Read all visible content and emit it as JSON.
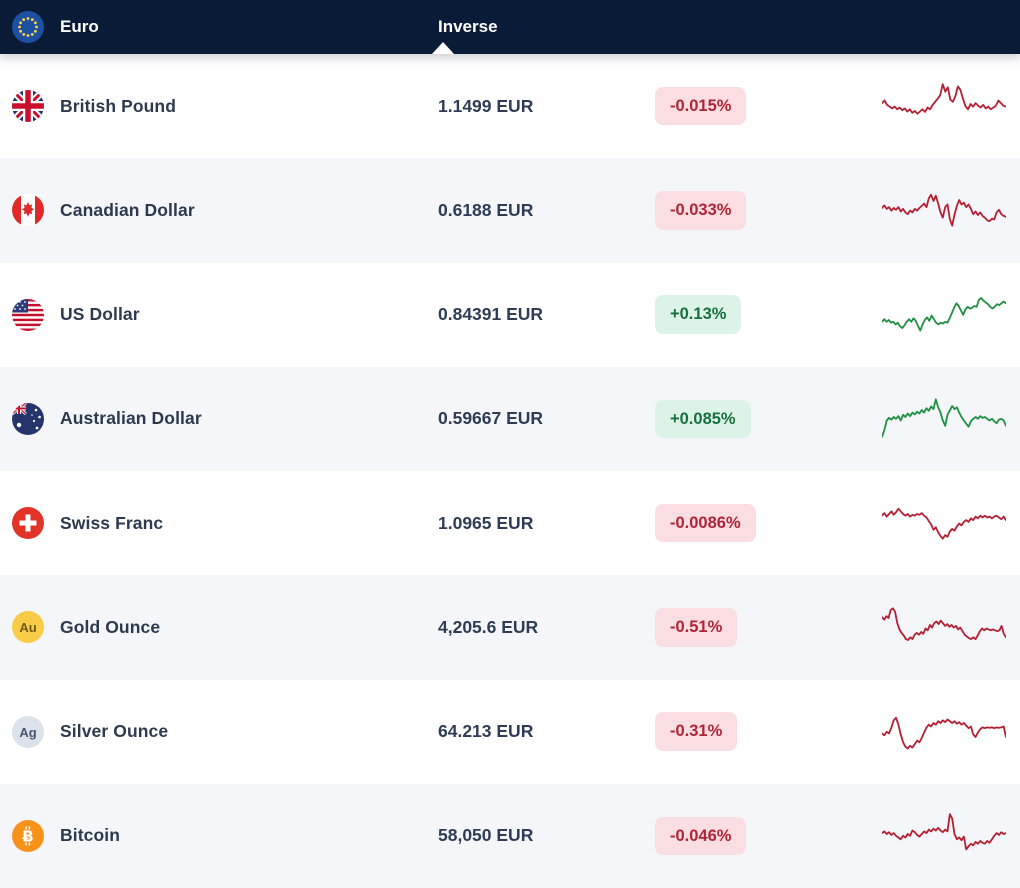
{
  "header": {
    "base_currency_label": "Euro",
    "base_flag_icon": "flag-eu",
    "column_label": "Inverse",
    "sort_indicator": "triangle-up"
  },
  "colors": {
    "header_bg": "#0a1b38",
    "row_alt_bg": "#f4f6f9",
    "text_dark": "#2d3a4e",
    "negative_text": "#b02437",
    "negative_bg": "#fbdee1",
    "positive_text": "#17713c",
    "positive_bg": "#def3e8",
    "spark_down": "#b41f33",
    "spark_up": "#1f8f41",
    "gold": "#f8cc46",
    "silver": "#dde2ea",
    "bitcoin_orange": "#f7931a"
  },
  "rows": [
    {
      "name": "British Pound",
      "icon": "flag-gb",
      "value": "1.1499 EUR",
      "change": "-0.015%",
      "direction": "down",
      "sparkline": [
        0.52,
        0.58,
        0.48,
        0.44,
        0.4,
        0.44,
        0.38,
        0.42,
        0.36,
        0.4,
        0.33,
        0.38,
        0.3,
        0.34,
        0.28,
        0.33,
        0.38,
        0.32,
        0.42,
        0.38,
        0.48,
        0.55,
        0.62,
        0.7,
        0.95,
        0.78,
        0.88,
        0.6,
        0.55,
        0.68,
        0.9,
        0.82,
        0.62,
        0.45,
        0.38,
        0.5,
        0.44,
        0.52,
        0.46,
        0.42,
        0.48,
        0.4,
        0.44,
        0.38,
        0.42,
        0.46,
        0.58,
        0.52,
        0.46,
        0.44
      ]
    },
    {
      "name": "Canadian Dollar",
      "icon": "flag-ca",
      "value": "0.6188 EUR",
      "change": "-0.033%",
      "direction": "down",
      "sparkline": [
        0.5,
        0.56,
        0.48,
        0.52,
        0.44,
        0.5,
        0.46,
        0.52,
        0.42,
        0.48,
        0.4,
        0.36,
        0.44,
        0.4,
        0.48,
        0.44,
        0.5,
        0.55,
        0.6,
        0.52,
        0.72,
        0.8,
        0.66,
        0.78,
        0.6,
        0.4,
        0.28,
        0.52,
        0.58,
        0.25,
        0.1,
        0.35,
        0.55,
        0.68,
        0.58,
        0.62,
        0.52,
        0.58,
        0.48,
        0.36,
        0.42,
        0.34,
        0.4,
        0.32,
        0.28,
        0.22,
        0.2,
        0.26,
        0.24,
        0.4,
        0.46,
        0.36,
        0.32,
        0.3
      ]
    },
    {
      "name": "US Dollar",
      "icon": "flag-us",
      "value": "0.84391 EUR",
      "change": "+0.13%",
      "direction": "up",
      "sparkline": [
        0.3,
        0.36,
        0.3,
        0.34,
        0.28,
        0.3,
        0.24,
        0.28,
        0.2,
        0.16,
        0.22,
        0.3,
        0.36,
        0.3,
        0.38,
        0.32,
        0.2,
        0.1,
        0.24,
        0.34,
        0.4,
        0.32,
        0.44,
        0.36,
        0.28,
        0.24,
        0.28,
        0.26,
        0.3,
        0.28,
        0.38,
        0.5,
        0.62,
        0.72,
        0.66,
        0.56,
        0.46,
        0.58,
        0.64,
        0.6,
        0.62,
        0.66,
        0.64,
        0.8,
        0.84,
        0.78,
        0.74,
        0.7,
        0.64,
        0.6,
        0.64,
        0.7,
        0.68,
        0.72,
        0.76,
        0.72
      ]
    },
    {
      "name": "Australian Dollar",
      "icon": "flag-au",
      "value": "0.59667 EUR",
      "change": "+0.085%",
      "direction": "up",
      "sparkline": [
        0.05,
        0.2,
        0.42,
        0.48,
        0.44,
        0.5,
        0.46,
        0.52,
        0.42,
        0.55,
        0.5,
        0.58,
        0.52,
        0.6,
        0.56,
        0.62,
        0.58,
        0.66,
        0.6,
        0.7,
        0.64,
        0.74,
        0.68,
        0.9,
        0.72,
        0.6,
        0.42,
        0.3,
        0.55,
        0.65,
        0.75,
        0.68,
        0.72,
        0.6,
        0.5,
        0.42,
        0.35,
        0.28,
        0.4,
        0.46,
        0.5,
        0.46,
        0.52,
        0.48,
        0.5,
        0.46,
        0.42,
        0.46,
        0.4,
        0.36,
        0.44,
        0.46,
        0.42,
        0.3
      ]
    },
    {
      "name": "Swiss Franc",
      "icon": "flag-ch",
      "value": "1.0965 EUR",
      "change": "-0.0086%",
      "direction": "down",
      "sparkline": [
        0.62,
        0.68,
        0.6,
        0.66,
        0.72,
        0.64,
        0.7,
        0.78,
        0.72,
        0.66,
        0.62,
        0.66,
        0.6,
        0.64,
        0.62,
        0.66,
        0.64,
        0.68,
        0.62,
        0.58,
        0.5,
        0.42,
        0.3,
        0.36,
        0.24,
        0.16,
        0.1,
        0.18,
        0.14,
        0.26,
        0.32,
        0.28,
        0.38,
        0.44,
        0.4,
        0.48,
        0.52,
        0.48,
        0.56,
        0.52,
        0.6,
        0.56,
        0.62,
        0.58,
        0.62,
        0.58,
        0.6,
        0.56,
        0.6,
        0.62,
        0.58,
        0.54,
        0.6,
        0.52
      ]
    },
    {
      "name": "Gold Ounce",
      "icon": "metal-gold",
      "value": "4,205.6 EUR",
      "change": "-0.51%",
      "direction": "down",
      "sparkline": [
        0.68,
        0.62,
        0.7,
        0.66,
        0.84,
        0.88,
        0.8,
        0.55,
        0.4,
        0.32,
        0.26,
        0.18,
        0.16,
        0.22,
        0.18,
        0.28,
        0.32,
        0.28,
        0.34,
        0.3,
        0.42,
        0.38,
        0.5,
        0.44,
        0.54,
        0.58,
        0.52,
        0.6,
        0.54,
        0.48,
        0.52,
        0.46,
        0.5,
        0.44,
        0.48,
        0.4,
        0.44,
        0.36,
        0.28,
        0.24,
        0.2,
        0.18,
        0.22,
        0.18,
        0.26,
        0.36,
        0.42,
        0.38,
        0.42,
        0.4,
        0.38,
        0.4,
        0.38,
        0.36,
        0.38,
        0.48,
        0.3,
        0.22
      ]
    },
    {
      "name": "Silver Ounce",
      "icon": "metal-silver",
      "value": "64.213 EUR",
      "change": "-0.31%",
      "direction": "down",
      "sparkline": [
        0.42,
        0.38,
        0.46,
        0.42,
        0.56,
        0.72,
        0.78,
        0.62,
        0.4,
        0.22,
        0.12,
        0.08,
        0.14,
        0.1,
        0.18,
        0.26,
        0.22,
        0.32,
        0.44,
        0.56,
        0.62,
        0.58,
        0.66,
        0.62,
        0.7,
        0.66,
        0.72,
        0.68,
        0.74,
        0.7,
        0.66,
        0.7,
        0.64,
        0.68,
        0.62,
        0.66,
        0.6,
        0.54,
        0.58,
        0.4,
        0.34,
        0.44,
        0.52,
        0.56,
        0.54,
        0.56,
        0.55,
        0.56,
        0.54,
        0.56,
        0.55,
        0.56,
        0.58,
        0.34
      ]
    },
    {
      "name": "Bitcoin",
      "icon": "crypto-bitcoin",
      "value": "58,050 EUR",
      "change": "-0.046%",
      "direction": "down",
      "sparkline": [
        0.52,
        0.56,
        0.5,
        0.54,
        0.48,
        0.52,
        0.46,
        0.42,
        0.38,
        0.46,
        0.42,
        0.5,
        0.46,
        0.58,
        0.54,
        0.48,
        0.44,
        0.5,
        0.56,
        0.52,
        0.6,
        0.56,
        0.62,
        0.58,
        0.64,
        0.58,
        0.54,
        0.6,
        0.56,
        0.95,
        0.85,
        0.5,
        0.38,
        0.42,
        0.36,
        0.44,
        0.15,
        0.22,
        0.28,
        0.24,
        0.32,
        0.28,
        0.34,
        0.3,
        0.28,
        0.34,
        0.3,
        0.38,
        0.46,
        0.52,
        0.48,
        0.54,
        0.5,
        0.52
      ]
    }
  ]
}
